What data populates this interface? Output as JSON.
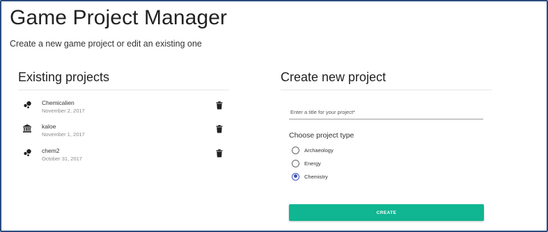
{
  "header": {
    "title": "Game Project Manager",
    "subtitle": "Create a new game project or edit an existing one"
  },
  "existing": {
    "heading": "Existing projects",
    "projects": [
      {
        "name": "Chemicalien",
        "date": "November 2, 2017",
        "type_icon": "chemistry-icon"
      },
      {
        "name": "kaloe",
        "date": "November 1, 2017",
        "type_icon": "archaeology-icon"
      },
      {
        "name": "chem2",
        "date": "October 31, 2017",
        "type_icon": "chemistry-icon"
      }
    ],
    "delete_icon": "trash-icon"
  },
  "create": {
    "heading": "Create new project",
    "title_placeholder": "Enter a title for your project*",
    "title_value": "",
    "type_label": "Choose project type",
    "types": [
      {
        "label": "Archaeology",
        "checked": false
      },
      {
        "label": "Energy",
        "checked": false
      },
      {
        "label": "Chemistry",
        "checked": true
      }
    ],
    "button_label": "CREATE"
  },
  "colors": {
    "accent": "#10b591",
    "radio_selected": "#3f51b5",
    "frame_border": "#2b4c7e"
  }
}
